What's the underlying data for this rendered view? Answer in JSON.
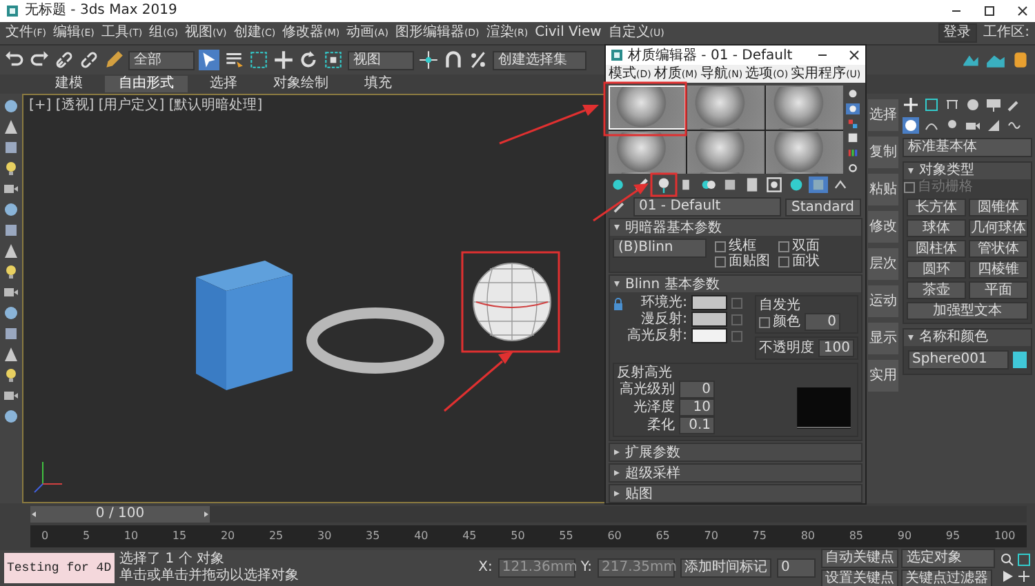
{
  "window": {
    "title": "无标题 - 3ds Max 2019"
  },
  "menu": [
    {
      "label": "文件",
      "shortcut": "(F)"
    },
    {
      "label": "编辑",
      "shortcut": "(E)"
    },
    {
      "label": "工具",
      "shortcut": "(T)"
    },
    {
      "label": "组",
      "shortcut": "(G)"
    },
    {
      "label": "视图",
      "shortcut": "(V)"
    },
    {
      "label": "创建",
      "shortcut": "(C)"
    },
    {
      "label": "修改器",
      "shortcut": "(M)"
    },
    {
      "label": "动画",
      "shortcut": "(A)"
    },
    {
      "label": "图形编辑器",
      "shortcut": "(D)"
    },
    {
      "label": "渲染",
      "shortcut": "(R)"
    },
    {
      "label": "Civil View"
    },
    {
      "label": "自定义",
      "shortcut": "(U)"
    }
  ],
  "account": {
    "login": "登录",
    "workspace_label": "工作区:"
  },
  "toolbar": {
    "selection_filter": "全部",
    "reference_coord": "视图",
    "selection_set": "创建选择集"
  },
  "ribbon_tabs": [
    {
      "label": "建模",
      "selected": false
    },
    {
      "label": "自由形式",
      "selected": true
    },
    {
      "label": "选择",
      "selected": false
    },
    {
      "label": "对象绘制",
      "selected": false
    },
    {
      "label": "填充",
      "selected": false
    }
  ],
  "viewport": {
    "label": "[+] [透视] [用户定义] [默认明暗处理]"
  },
  "material_editor": {
    "title": "材质编辑器 - 01 - Default",
    "menu": [
      {
        "label": "模式",
        "shortcut": "(D)"
      },
      {
        "label": "材质",
        "shortcut": "(M)"
      },
      {
        "label": "导航",
        "shortcut": "(N)"
      },
      {
        "label": "选项",
        "shortcut": "(O)"
      },
      {
        "label": "实用程序",
        "shortcut": "(U)"
      }
    ],
    "samples": [
      {
        "selected": true
      },
      {
        "selected": false
      },
      {
        "selected": false
      },
      {
        "selected": false
      },
      {
        "selected": false
      },
      {
        "selected": false
      }
    ],
    "material_name": "01 - Default",
    "material_type": "Standard",
    "shader_rollout": {
      "title": "明暗器基本参数",
      "expanded": true,
      "shader": "(B)Blinn",
      "options": [
        {
          "label": "线框",
          "checked": false
        },
        {
          "label": "双面",
          "checked": false
        },
        {
          "label": "面贴图",
          "checked": false
        },
        {
          "label": "面状",
          "checked": false
        }
      ]
    },
    "blinn_rollout": {
      "title": "Blinn 基本参数",
      "expanded": true,
      "colors": [
        {
          "label": "环境光:",
          "color": "#c4c4c4"
        },
        {
          "label": "漫反射:",
          "color": "#c4c4c4"
        },
        {
          "label": "高光反射:",
          "color": "#f2f2f2"
        }
      ],
      "self_illum": {
        "title": "自发光",
        "color_label": "颜色",
        "color_checked": false,
        "value": "0"
      },
      "opacity": {
        "label": "不透明度",
        "value": "100"
      },
      "specular": {
        "title": "反射高光",
        "fields": [
          {
            "label": "高光级别",
            "value": "0"
          },
          {
            "label": "光泽度",
            "value": "10"
          },
          {
            "label": "柔化",
            "value": "0.1"
          }
        ]
      }
    },
    "collapsed_rollouts": [
      {
        "title": "扩展参数",
        "expanded": false
      },
      {
        "title": "超级采样",
        "expanded": false
      },
      {
        "title": "贴图",
        "expanded": false
      }
    ]
  },
  "command_panel": {
    "tabs": [
      "选择",
      "复制",
      "粘贴",
      "修改",
      "层次",
      "运动",
      "显示",
      "实用"
    ],
    "category": "标准基本体",
    "object_type": {
      "title": "对象类型",
      "expanded": true,
      "autogrid": {
        "label": "自动栅格",
        "checked": false,
        "disabled": true
      },
      "buttons": [
        "长方体",
        "圆锥体",
        "球体",
        "几何球体",
        "圆柱体",
        "管状体",
        "圆环",
        "四棱锥",
        "茶壶",
        "平面",
        "加强型文本"
      ]
    },
    "name_color": {
      "title": "名称和颜色",
      "expanded": true,
      "name": "Sphere001"
    }
  },
  "timeline": {
    "frame": "0 / 100",
    "level": 0,
    "ticks": [
      "0",
      "5",
      "10",
      "15",
      "20",
      "25",
      "30",
      "35",
      "40",
      "45",
      "50",
      "55",
      "60",
      "65",
      "70",
      "75",
      "80",
      "85",
      "90",
      "95",
      "100"
    ]
  },
  "status": {
    "listener": "Testing for 4D",
    "selection": "选择了 1 个 对象",
    "prompt": "单击或单击并拖动以选择对象",
    "x_label": "X:",
    "x": "121.36mm",
    "y_label": "Y:",
    "y": "217.35mm",
    "time_tag": "添加时间标记",
    "time": "0",
    "auto_key": "自动关键点",
    "key_mode": "选定对象",
    "set_key": "设置关键点",
    "key_filters": "关键点过滤器"
  }
}
